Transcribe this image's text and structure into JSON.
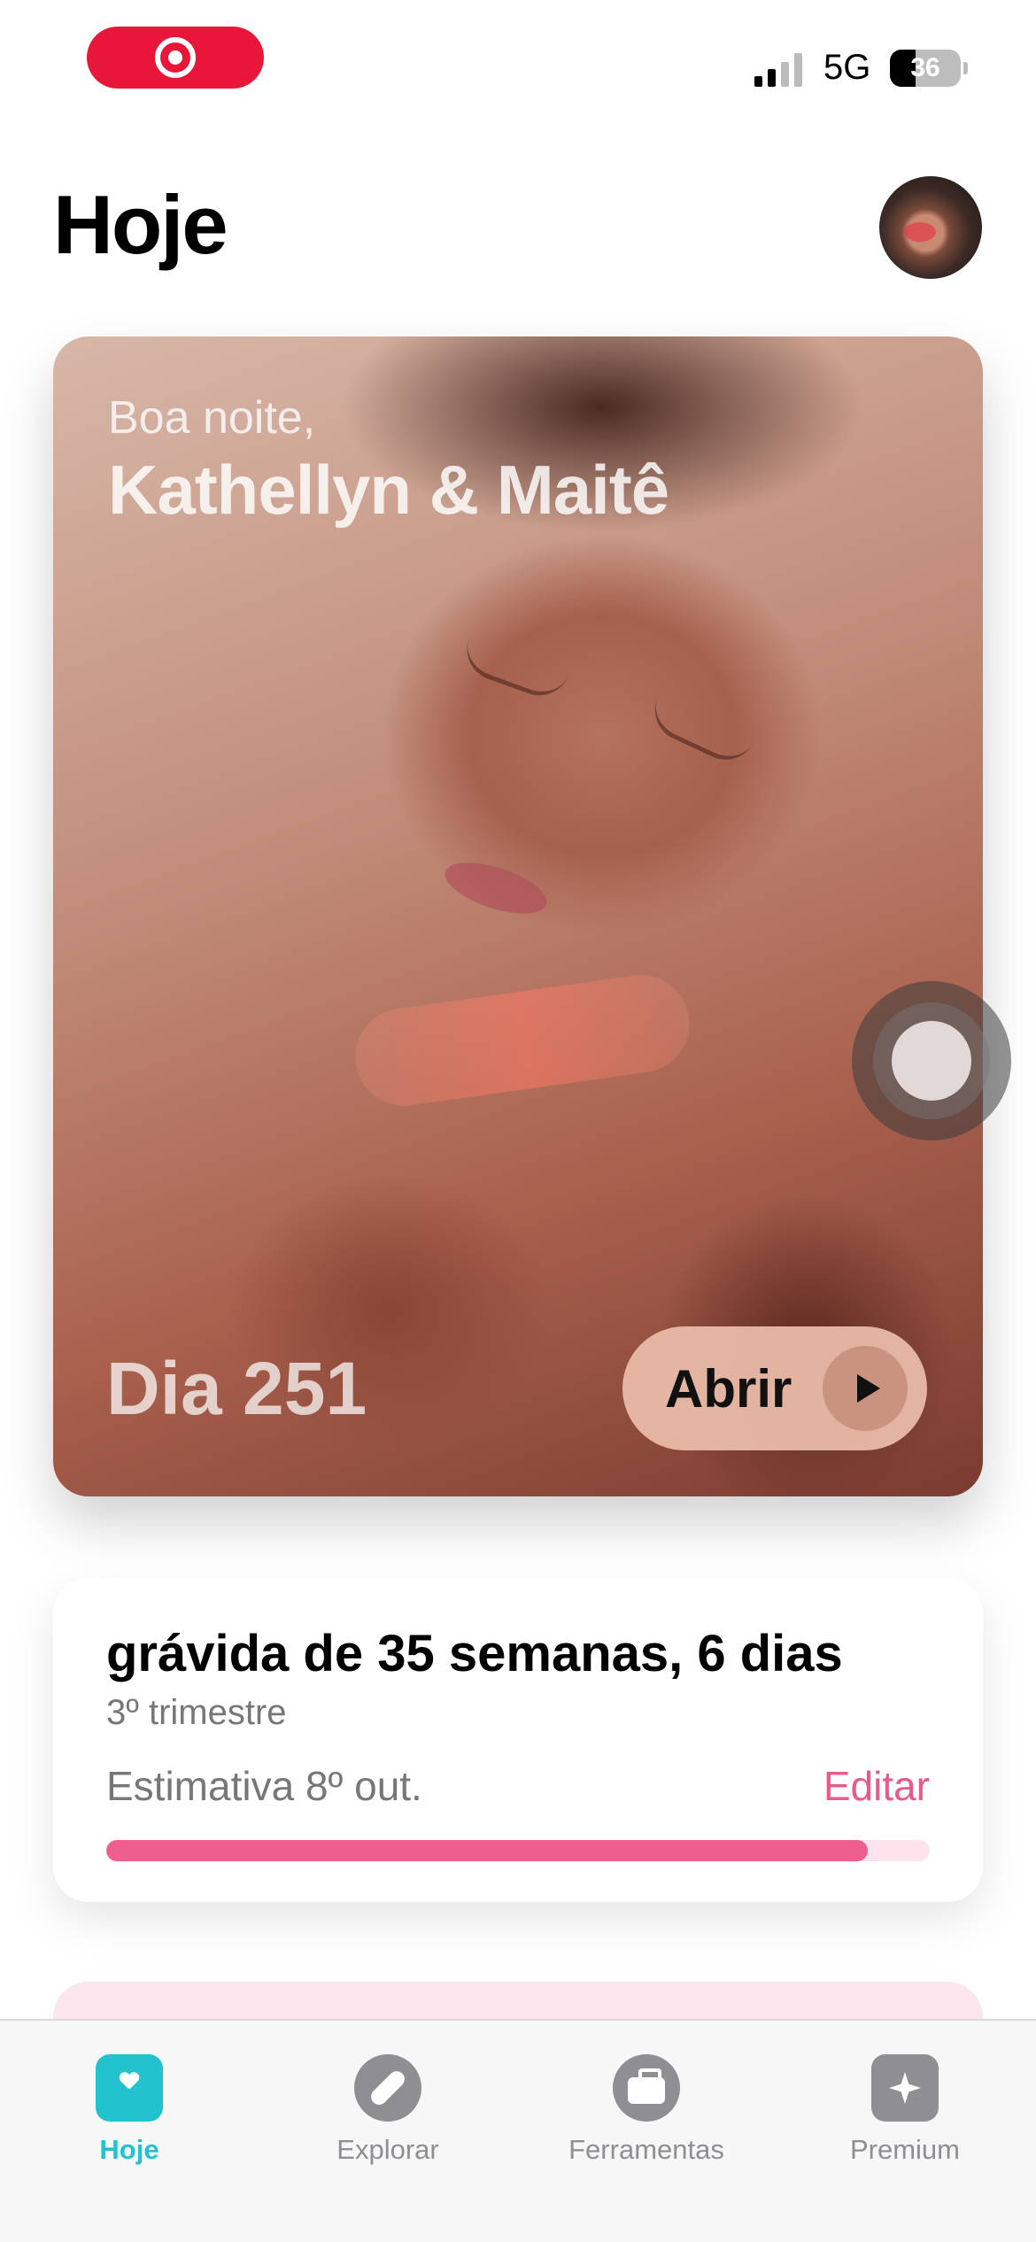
{
  "status_bar": {
    "network": "5G",
    "battery_percent": "36",
    "battery_level": 0.36
  },
  "header": {
    "title": "Hoje"
  },
  "hero": {
    "greeting": "Boa noite,",
    "names": "Kathellyn & Maitê",
    "day_label": "Dia 251",
    "open_label": "Abrir"
  },
  "pregnancy": {
    "title": "grávida de 35 semanas, 6 dias",
    "trimester": "3º trimestre",
    "estimate": "Estimativa 8º out.",
    "edit_label": "Editar",
    "progress": 0.925,
    "progress_color": "#ee5f8f"
  },
  "tab_bar": {
    "items": [
      {
        "label": "Hoje",
        "icon": "journal-heart-icon",
        "active": true
      },
      {
        "label": "Explorar",
        "icon": "compass-icon",
        "active": false
      },
      {
        "label": "Ferramentas",
        "icon": "briefcase-icon",
        "active": false
      },
      {
        "label": "Premium",
        "icon": "sparkle-icon",
        "active": false
      }
    ],
    "active_color": "#22c2cf",
    "inactive_color": "#8e8e93"
  }
}
